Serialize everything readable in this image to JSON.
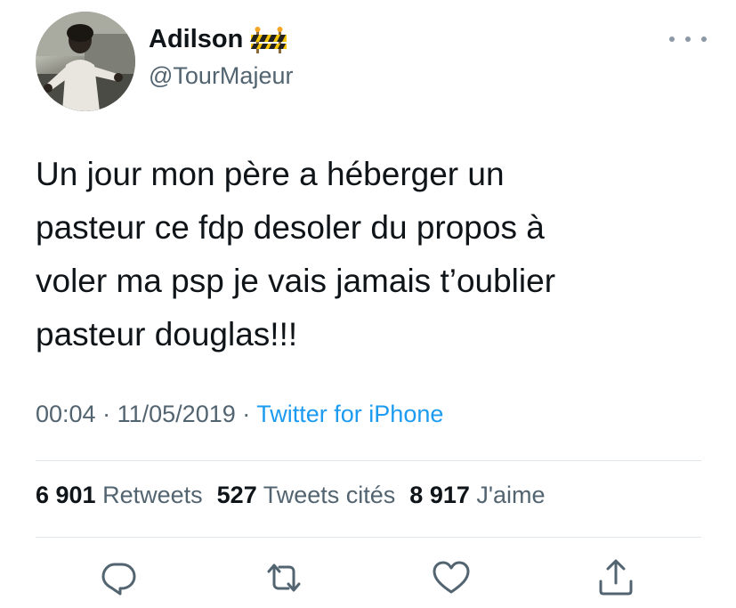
{
  "author": {
    "display_name": "Adilson",
    "handle": "@TourMajeur",
    "badge_icon": "construction-barrier-icon"
  },
  "tweet": {
    "lines": [
      "Un jour mon père a héberger un",
      "pasteur ce fdp desoler du propos à",
      "voler ma psp je vais jamais t’oublier",
      "pasteur douglas!!!"
    ],
    "time": "00:04",
    "date": "11/05/2019",
    "separator": "·",
    "source": "Twitter for iPhone"
  },
  "stats": {
    "retweets_count": "6 901",
    "retweets_label": "Retweets",
    "quotes_count": "527",
    "quotes_label": "Tweets cités",
    "likes_count": "8 917",
    "likes_label": "J'aime"
  },
  "actions": [
    "reply-icon",
    "retweet-icon",
    "like-icon",
    "share-icon"
  ],
  "colors": {
    "text": "#0f1419",
    "secondary": "#536471",
    "link": "#1d9bf0",
    "divider": "#e1e6ea"
  }
}
